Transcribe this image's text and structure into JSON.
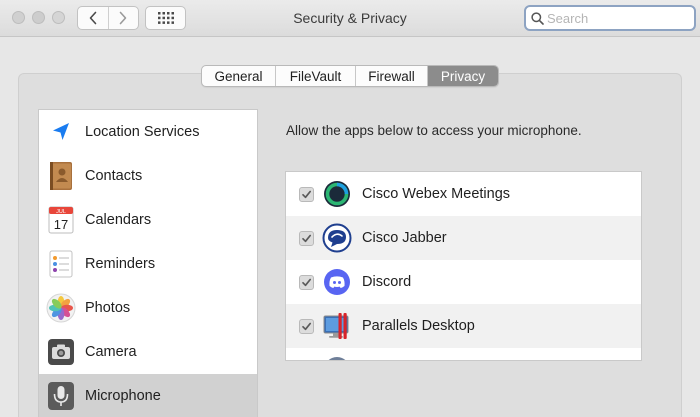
{
  "window": {
    "title": "Security & Privacy",
    "search_placeholder": "Search"
  },
  "tabs": [
    {
      "label": "General",
      "active": false
    },
    {
      "label": "FileVault",
      "active": false
    },
    {
      "label": "Firewall",
      "active": false
    },
    {
      "label": "Privacy",
      "active": true
    }
  ],
  "sidebar": {
    "items": [
      {
        "label": "Location Services",
        "icon": "location-arrow-icon",
        "selected": false
      },
      {
        "label": "Contacts",
        "icon": "contacts-book-icon",
        "selected": false
      },
      {
        "label": "Calendars",
        "icon": "calendar-icon",
        "selected": false,
        "icon_month": "JUL",
        "icon_day": "17"
      },
      {
        "label": "Reminders",
        "icon": "reminders-icon",
        "selected": false
      },
      {
        "label": "Photos",
        "icon": "photos-icon",
        "selected": false
      },
      {
        "label": "Camera",
        "icon": "camera-icon",
        "selected": false
      },
      {
        "label": "Microphone",
        "icon": "microphone-icon",
        "selected": true
      }
    ]
  },
  "pane": {
    "description": "Allow the apps below to access your microphone.",
    "apps": [
      {
        "label": "Cisco Webex Meetings",
        "icon": "webex-icon",
        "checked": true
      },
      {
        "label": "Cisco Jabber",
        "icon": "jabber-icon",
        "checked": true
      },
      {
        "label": "Discord",
        "icon": "discord-icon",
        "checked": true
      },
      {
        "label": "Parallels Desktop",
        "icon": "parallels-icon",
        "checked": true
      }
    ]
  },
  "colors": {
    "selected_tab": "#8c8c8c",
    "selected_sidebar": "#d1d1d1",
    "location_blue": "#1a7cf0",
    "discord_blurple": "#5865f2",
    "parallels_red": "#d8232a"
  }
}
